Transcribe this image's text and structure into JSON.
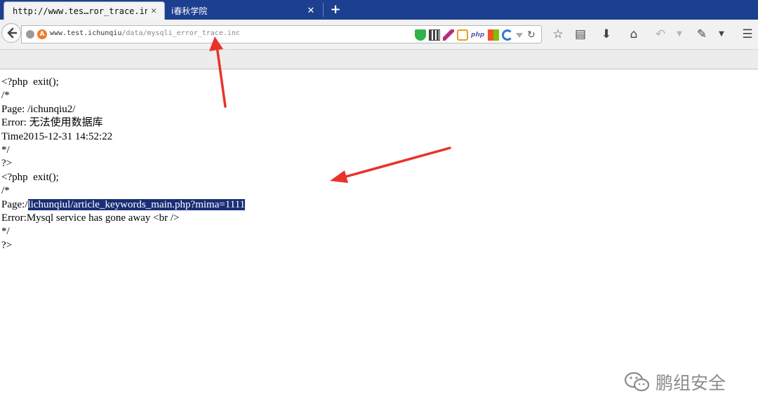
{
  "tabs": [
    {
      "title": "http://www.tes…ror_trace.inc",
      "close": "✕"
    },
    {
      "title": "i春秋学院",
      "close": "✕"
    }
  ],
  "new_tab_label": "+",
  "address_bar": {
    "host": "www.test.ichunqiu",
    "path": "/data/mysqli_error_trace.inc",
    "addon_letter": "A",
    "php_badge": "php"
  },
  "page_lines": [
    "<?php  exit();",
    "/*",
    "Page: /ichunqiu2/",
    "Error: 无法使用数据库",
    "Time2015-12-31 14:52:22",
    "*/",
    "?>",
    "<?php  exit();",
    "/*"
  ],
  "page_line_highlight": {
    "prefix": "Page:/",
    "selected": "lichunqiul/article_keywords_main.php?mima=1111"
  },
  "page_lines_tail": [
    "Error:Mysql service has gone away <br />",
    "*/",
    "?>"
  ],
  "watermark": "鹏组安全",
  "colors": {
    "tabstrip": "#1d3f8f",
    "selection": "#1a2e76",
    "annotation_arrow": "#e8332a"
  }
}
